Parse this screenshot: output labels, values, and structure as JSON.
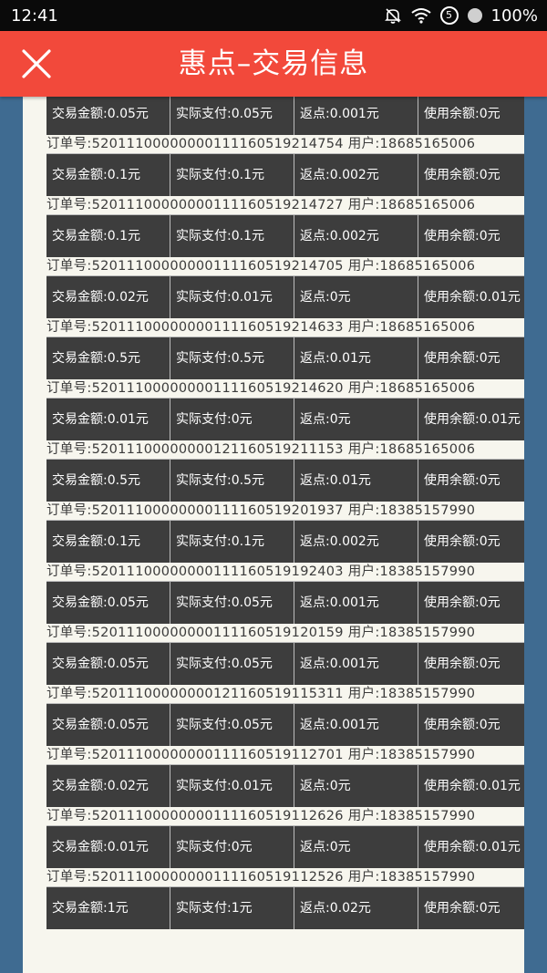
{
  "status_bar": {
    "time": "12:41",
    "badge": "5",
    "battery": "100%"
  },
  "app_bar": {
    "title": "惠点–交易信息",
    "close_icon": "close-icon"
  },
  "colors": {
    "app_bar": "#f2493b",
    "row_background": "#3d3d3d",
    "panel": "#f7f6ee",
    "page_background": "#3f6b91"
  },
  "records": [
    {
      "amount": "交易金额:0.05元",
      "paid": "实际支付:0.05元",
      "rebate": "返点:0.001元",
      "balance": "使用余额:0元"
    },
    {
      "order": "订单号:52011100000000111160519214754 用户:18685165006",
      "amount": "交易金额:0.1元",
      "paid": "实际支付:0.1元",
      "rebate": "返点:0.002元",
      "balance": "使用余额:0元"
    },
    {
      "order": "订单号:52011100000000111160519214727 用户:18685165006",
      "amount": "交易金额:0.1元",
      "paid": "实际支付:0.1元",
      "rebate": "返点:0.002元",
      "balance": "使用余额:0元"
    },
    {
      "order": "订单号:52011100000000111160519214705 用户:18685165006",
      "amount": "交易金额:0.02元",
      "paid": "实际支付:0.01元",
      "rebate": "返点:0元",
      "balance": "使用余额:0.01元"
    },
    {
      "order": "订单号:52011100000000111160519214633 用户:18685165006",
      "amount": "交易金额:0.5元",
      "paid": "实际支付:0.5元",
      "rebate": "返点:0.01元",
      "balance": "使用余额:0元"
    },
    {
      "order": "订单号:52011100000000111160519214620 用户:18685165006",
      "amount": "交易金额:0.01元",
      "paid": "实际支付:0元",
      "rebate": "返点:0元",
      "balance": "使用余额:0.01元"
    },
    {
      "order": "订单号:52011100000000121160519211153 用户:18685165006",
      "amount": "交易金额:0.5元",
      "paid": "实际支付:0.5元",
      "rebate": "返点:0.01元",
      "balance": "使用余额:0元"
    },
    {
      "order": "订单号:52011100000000111160519201937 用户:18385157990",
      "amount": "交易金额:0.1元",
      "paid": "实际支付:0.1元",
      "rebate": "返点:0.002元",
      "balance": "使用余额:0元"
    },
    {
      "order": "订单号:52011100000000111160519192403 用户:18385157990",
      "amount": "交易金额:0.05元",
      "paid": "实际支付:0.05元",
      "rebate": "返点:0.001元",
      "balance": "使用余额:0元"
    },
    {
      "order": "订单号:52011100000000111160519120159 用户:18385157990",
      "amount": "交易金额:0.05元",
      "paid": "实际支付:0.05元",
      "rebate": "返点:0.001元",
      "balance": "使用余额:0元"
    },
    {
      "order": "订单号:52011100000000121160519115311 用户:18385157990",
      "amount": "交易金额:0.05元",
      "paid": "实际支付:0.05元",
      "rebate": "返点:0.001元",
      "balance": "使用余额:0元"
    },
    {
      "order": "订单号:52011100000000111160519112701 用户:18385157990",
      "amount": "交易金额:0.02元",
      "paid": "实际支付:0.01元",
      "rebate": "返点:0元",
      "balance": "使用余额:0.01元"
    },
    {
      "order": "订单号:52011100000000111160519112626 用户:18385157990",
      "amount": "交易金额:0.01元",
      "paid": "实际支付:0元",
      "rebate": "返点:0元",
      "balance": "使用余额:0.01元"
    },
    {
      "order": "订单号:52011100000000111160519112526 用户:18385157990",
      "amount": "交易金额:1元",
      "paid": "实际支付:1元",
      "rebate": "返点:0.02元",
      "balance": "使用余额:0元"
    }
  ]
}
